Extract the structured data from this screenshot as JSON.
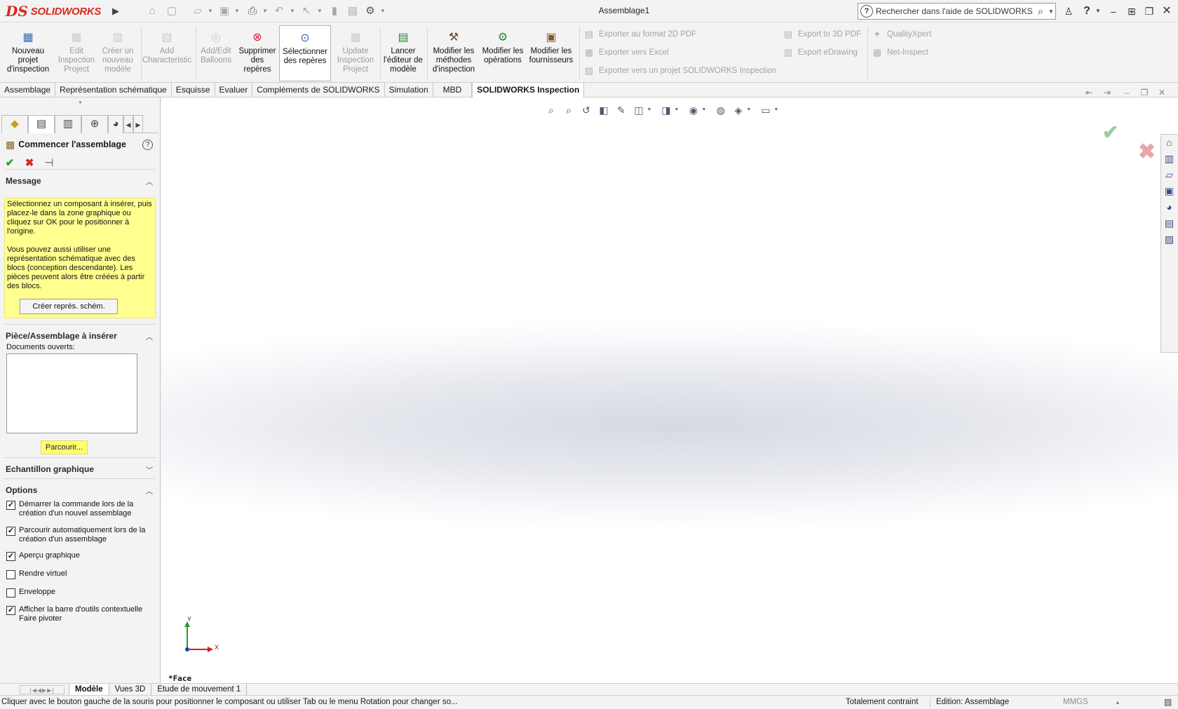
{
  "app": {
    "name": "SOLIDWORKS",
    "doc_title": "Assemblage1"
  },
  "search": {
    "placeholder": "Rechercher dans l'aide de SOLIDWORKS"
  },
  "command_manager": {
    "buttons": [
      {
        "label": "Nouveau projet d'inspection",
        "enabled": true
      },
      {
        "label": "Edit Inspection Project",
        "enabled": false
      },
      {
        "label": "Créer un nouveau modèle",
        "enabled": false
      },
      {
        "label": "Add Characteristic",
        "enabled": false
      },
      {
        "label": "Add/Edit Balloons",
        "enabled": false
      },
      {
        "label": "Supprimer des repères",
        "enabled": true
      },
      {
        "label": "Sélectionner des repères",
        "enabled": true,
        "selected": true
      },
      {
        "label": "Update Inspection Project",
        "enabled": false
      },
      {
        "label": "Lancer l'éditeur de modèle",
        "enabled": true
      },
      {
        "label": "Modifier les méthodes d'inspection",
        "enabled": true
      },
      {
        "label": "Modifier les opérations",
        "enabled": true
      },
      {
        "label": "Modifier les fournisseurs",
        "enabled": true
      }
    ],
    "exports": [
      "Exporter au format 2D PDF",
      "Exporter vers Excel",
      "Exporter vers un projet SOLIDWORKS Inspection",
      "Export to 3D PDF",
      "Export eDrawing",
      "QualityXpert",
      "Net-Inspect"
    ]
  },
  "tabs": [
    "Assemblage",
    "Représentation schématique",
    "Esquisse",
    "Evaluer",
    "Compléments de SOLIDWORKS",
    "Simulation",
    "MBD",
    "SOLIDWORKS Inspection"
  ],
  "active_tab": "SOLIDWORKS Inspection",
  "property_manager": {
    "title": "Commencer l'assemblage",
    "message": {
      "header": "Message",
      "para1": "Sélectionnez un composant à insérer, puis placez-le dans la zone graphique ou cliquez sur OK pour le positionner à l'origine.",
      "para2": "Vous pouvez aussi utiliser une représentation schématique avec des blocs (conception descendante). Les pièces peuvent alors être créées à partir des blocs.",
      "button": "Créer représ. schém."
    },
    "insert": {
      "header": "Pièce/Assemblage à insérer",
      "docs_label": "Documents ouverts:",
      "browse": "Parcourir..."
    },
    "sample": {
      "header": "Echantillon graphique"
    },
    "options": {
      "header": "Options",
      "items": [
        {
          "label": "Démarrer la commande lors de la création d'un nouvel assemblage",
          "checked": true
        },
        {
          "label": "Parcourir automatiquement lors de la création d'un assemblage",
          "checked": true
        },
        {
          "label": "Aperçu graphique",
          "checked": true
        },
        {
          "label": "Rendre virtuel",
          "checked": false
        },
        {
          "label": "Enveloppe",
          "checked": false
        },
        {
          "label": "Afficher la barre d'outils contextuelle Faire pivoter",
          "checked": true
        }
      ]
    }
  },
  "viewport": {
    "view_label": "*Face",
    "triad": {
      "x": "X",
      "y": "Y"
    }
  },
  "bottom_tabs": [
    "Modèle",
    "Vues 3D",
    "Etude de mouvement 1"
  ],
  "active_bottom_tab": "Modèle",
  "status": {
    "message": "Cliquer avec le bouton gauche de la souris pour positionner le composant ou utiliser Tab ou le menu Rotation pour changer so...",
    "constraint": "Totalement contraint",
    "edit": "Edition: Assemblage",
    "units": "MMGS"
  },
  "colors": {
    "brand_red": "#da291c",
    "message_yellow": "#ffff90",
    "ok_green": "#2e9a2e",
    "cancel_red": "#d12b2b"
  }
}
